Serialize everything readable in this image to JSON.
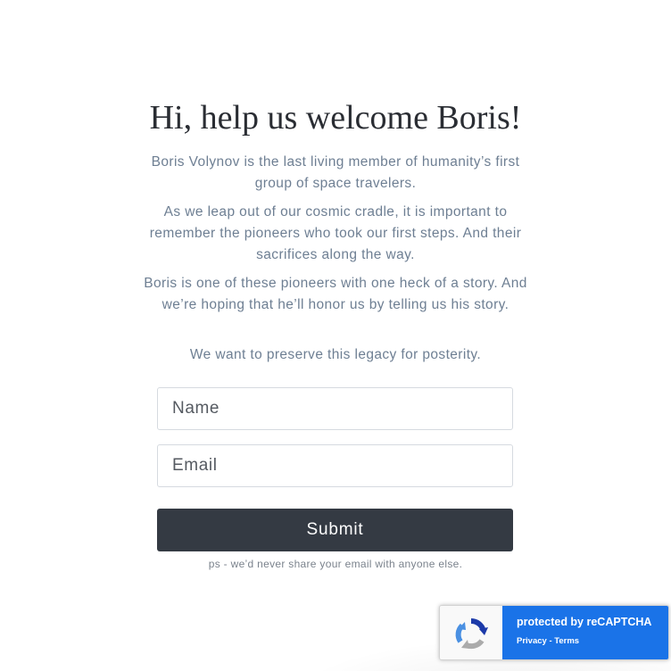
{
  "heading": "Hi, help us welcome Boris!",
  "paragraphs": [
    "Boris Volynov is the last living member of humanity’s first group of space travelers.",
    "As we leap out of our cosmic cradle, it is important to remember the pioneers who took our first steps. And their sacrifices along the way.",
    "Boris is one of these pioneers with one heck of a story. And we’re hoping that he’ll honor us by telling us his story.",
    "We want to preserve this legacy for posterity."
  ],
  "form": {
    "name_placeholder": "Name",
    "email_placeholder": "Email",
    "submit_label": "Submit",
    "note": "ps - we’d never share your email with anyone else."
  },
  "recaptcha": {
    "protected_text": "protected by reCAPTCHA",
    "privacy_label": "Privacy",
    "separator": " - ",
    "terms_label": "Terms",
    "icon": "recaptcha-logo-icon"
  },
  "colors": {
    "button_bg": "#343a43",
    "recaptcha_blue": "#1a73e8",
    "body_text": "#6e7f93",
    "heading_text": "#2a2d33"
  }
}
